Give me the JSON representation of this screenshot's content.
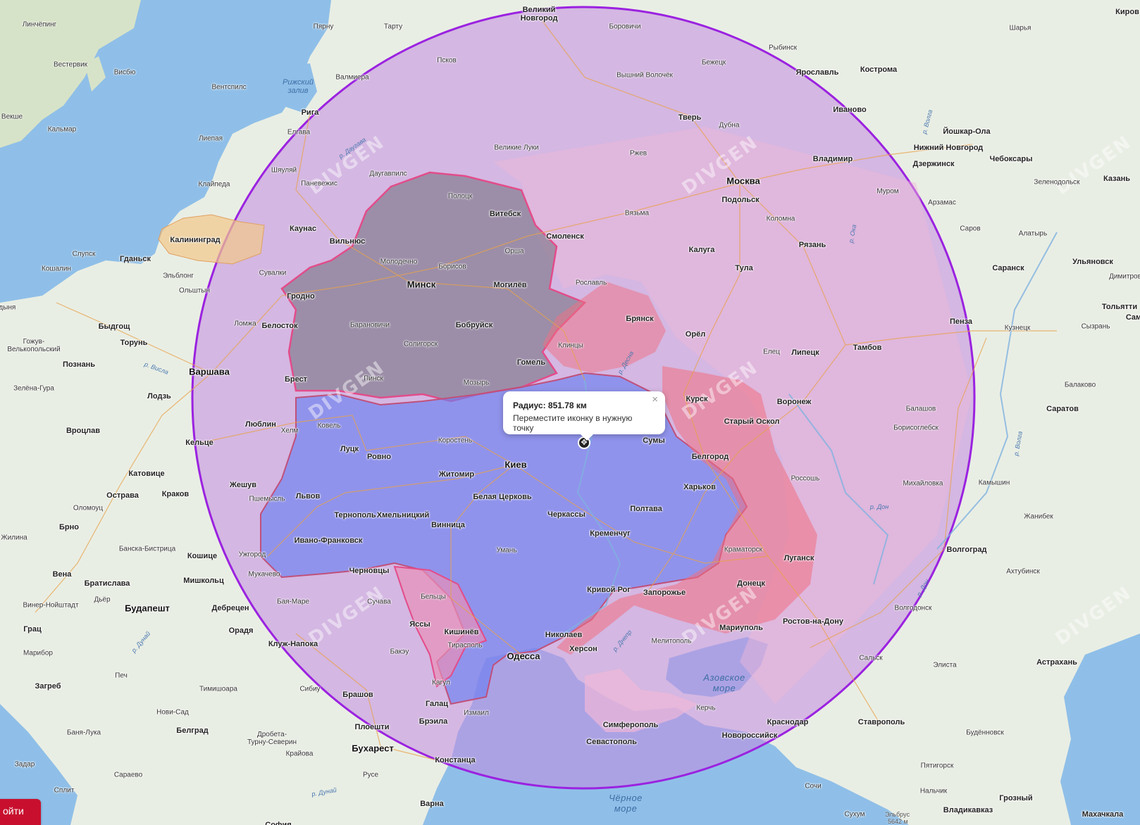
{
  "radius_popup": {
    "title": "Радиус: 851.78 км",
    "hint": "Переместите иконку в нужную точку",
    "close": "×"
  },
  "marker": {
    "glyph": "✥"
  },
  "login_button": {
    "label": "ойти"
  },
  "watermark": "DIVGEN",
  "elbrus": {
    "name": "Эльбрус",
    "height": "5642 м"
  },
  "seas": {
    "azov": "Азовское\nморе",
    "black": "Чёрное\nморе",
    "riga": "Рижский\nзалив"
  },
  "colors": {
    "circle_fill": "#b36bd8",
    "circle_stroke": "#9b22e0",
    "ukraine_fill": "#6b7ff0",
    "belarus_fill": "#6e6e78",
    "russia_fill": "#f0b8d8",
    "occupied_fill": "#f07080",
    "moldova_fill": "#e88fb8",
    "kaliningrad_fill": "#f2c88a"
  },
  "cities": [
    {
      "id": "velikiy-novgorod",
      "name": "Великий\nНовгород",
      "cls": "big"
    },
    {
      "id": "borovichi",
      "name": "Боровичи",
      "cls": "city"
    },
    {
      "id": "rybinsk",
      "name": "Рыбинск",
      "cls": "city"
    },
    {
      "id": "sharya",
      "name": "Шарья",
      "cls": "city"
    },
    {
      "id": "kirov",
      "name": "Киров",
      "cls": "big"
    },
    {
      "id": "linchoping",
      "name": "Линчёпинг",
      "cls": "city"
    },
    {
      "id": "parnu",
      "name": "Пярну",
      "cls": "city"
    },
    {
      "id": "tartu",
      "name": "Тарту",
      "cls": "city"
    },
    {
      "id": "pskov",
      "name": "Псков",
      "cls": "city"
    },
    {
      "id": "bezhetsk",
      "name": "Бежецк",
      "cls": "city"
    },
    {
      "id": "yaroslavl",
      "name": "Ярославль",
      "cls": "big"
    },
    {
      "id": "kostroma",
      "name": "Кострома",
      "cls": "big"
    },
    {
      "id": "vestervik",
      "name": "Вестервик",
      "cls": "city"
    },
    {
      "id": "visbyu",
      "name": "Висбю",
      "cls": "city"
    },
    {
      "id": "valmiera",
      "name": "Валмиера",
      "cls": "city"
    },
    {
      "id": "vyshniy-volochek",
      "name": "Вышний Волочёк",
      "cls": "city"
    },
    {
      "id": "ventspils",
      "name": "Вентспилс",
      "cls": "city"
    },
    {
      "id": "riga",
      "name": "Рига",
      "cls": "big"
    },
    {
      "id": "tver",
      "name": "Тверь",
      "cls": "big"
    },
    {
      "id": "ivanovo",
      "name": "Иваново",
      "cls": "big"
    },
    {
      "id": "vekshe",
      "name": "Векше",
      "cls": "city"
    },
    {
      "id": "kalmar",
      "name": "Кальмар",
      "cls": "city"
    },
    {
      "id": "elgava",
      "name": "Елгава",
      "cls": "city"
    },
    {
      "id": "dubna",
      "name": "Дубна",
      "cls": "city"
    },
    {
      "id": "yoshkar-ola",
      "name": "Йошкар-Ола",
      "cls": "big"
    },
    {
      "id": "liepaya",
      "name": "Лиепая",
      "cls": "city"
    },
    {
      "id": "velikie-luki",
      "name": "Великие Луки",
      "cls": "city"
    },
    {
      "id": "rzhev",
      "name": "Ржев",
      "cls": "city"
    },
    {
      "id": "n-novgorod",
      "name": "Нижний Новгород",
      "cls": "big"
    },
    {
      "id": "cheboksary",
      "name": "Чебоксары",
      "cls": "big"
    },
    {
      "id": "vladimir",
      "name": "Владимир",
      "cls": "big"
    },
    {
      "id": "dzerzhinsk",
      "name": "Дзержинск",
      "cls": "big"
    },
    {
      "id": "shyaulyai",
      "name": "Шяуляй",
      "cls": "city"
    },
    {
      "id": "daugavpils",
      "name": "Даугавпилс",
      "cls": "city"
    },
    {
      "id": "zelenodolsk",
      "name": "Зеленодольск",
      "cls": "city"
    },
    {
      "id": "kazan",
      "name": "Казань",
      "cls": "big"
    },
    {
      "id": "moskva",
      "name": "Москва",
      "cls": "capital"
    },
    {
      "id": "klaipeda",
      "name": "Клайпеда",
      "cls": "city"
    },
    {
      "id": "panevezhis",
      "name": "Паневежис",
      "cls": "city"
    },
    {
      "id": "polotsk",
      "name": "Полоцк",
      "cls": "city"
    },
    {
      "id": "podolsk",
      "name": "Подольск",
      "cls": "big"
    },
    {
      "id": "murom",
      "name": "Муром",
      "cls": "city"
    },
    {
      "id": "arzamas",
      "name": "Арзамас",
      "cls": "city"
    },
    {
      "id": "vitebsk",
      "name": "Витебск",
      "cls": "big"
    },
    {
      "id": "vyazma",
      "name": "Вязьма",
      "cls": "city"
    },
    {
      "id": "kolomna",
      "name": "Коломна",
      "cls": "city"
    },
    {
      "id": "kaliningrad",
      "name": "Калининград",
      "cls": "big"
    },
    {
      "id": "kaunas",
      "name": "Каунас",
      "cls": "big"
    },
    {
      "id": "smolensk",
      "name": "Смоленск",
      "cls": "big"
    },
    {
      "id": "saransk-s",
      "name": "Саров",
      "cls": "city"
    },
    {
      "id": "alatyr",
      "name": "Алатырь",
      "cls": "city"
    },
    {
      "id": "vilnyus",
      "name": "Вильнюс",
      "cls": "big"
    },
    {
      "id": "ryazan",
      "name": "Рязань",
      "cls": "big"
    },
    {
      "id": "orsha",
      "name": "Орша",
      "cls": "city"
    },
    {
      "id": "kaluga",
      "name": "Калуга",
      "cls": "big"
    },
    {
      "id": "slupsk",
      "name": "Слупск",
      "cls": "city"
    },
    {
      "id": "gdansk",
      "name": "Гданьск",
      "cls": "big"
    },
    {
      "id": "ulyanovsk",
      "name": "Ульяновск",
      "cls": "big"
    },
    {
      "id": "molodechno",
      "name": "Молодечно",
      "cls": "city"
    },
    {
      "id": "kosholin",
      "name": "Кошалин",
      "cls": "city"
    },
    {
      "id": "elblong",
      "name": "Эльблонг",
      "cls": "city"
    },
    {
      "id": "suvalki",
      "name": "Сувалки",
      "cls": "city"
    },
    {
      "id": "borisov",
      "name": "Борисов",
      "cls": "city"
    },
    {
      "id": "tula",
      "name": "Тула",
      "cls": "big"
    },
    {
      "id": "saransk",
      "name": "Саранск",
      "cls": "big"
    },
    {
      "id": "dimitrovgrad",
      "name": "Димитров",
      "cls": "city"
    },
    {
      "id": "minsk",
      "name": "Минск",
      "cls": "capital"
    },
    {
      "id": "mogilev",
      "name": "Могилёв",
      "cls": "big"
    },
    {
      "id": "roslavl",
      "name": "Рославль",
      "cls": "city"
    },
    {
      "id": "olshtyn",
      "name": "Ольштын",
      "cls": "city"
    },
    {
      "id": "grodno",
      "name": "Гродно",
      "cls": "big"
    },
    {
      "id": "tolyatti",
      "name": "Тольятти",
      "cls": "big"
    },
    {
      "id": "gdynia",
      "name": "Гдыня",
      "cls": "city"
    },
    {
      "id": "lomzha",
      "name": "Ломжа",
      "cls": "city"
    },
    {
      "id": "bryansk",
      "name": "Брянск",
      "cls": "big"
    },
    {
      "id": "penza",
      "name": "Пенза",
      "cls": "big"
    },
    {
      "id": "syzran",
      "name": "Сызрань",
      "cls": "city"
    },
    {
      "id": "samara",
      "name": "Сам",
      "cls": "big"
    },
    {
      "id": "bydgoshch",
      "name": "Быдгощ",
      "cls": "big"
    },
    {
      "id": "belostok",
      "name": "Белосток",
      "cls": "big"
    },
    {
      "id": "baranovichi",
      "name": "Барановичи",
      "cls": "city"
    },
    {
      "id": "bobruysk",
      "name": "Бобруйск",
      "cls": "big"
    },
    {
      "id": "kuznetsk",
      "name": "Кузнецк",
      "cls": "city"
    },
    {
      "id": "orel",
      "name": "Орёл",
      "cls": "big"
    },
    {
      "id": "torun",
      "name": "Торунь",
      "cls": "big"
    },
    {
      "id": "gozhuv",
      "name": "Гожув-\nВелькопольский",
      "cls": "city"
    },
    {
      "id": "klintsy",
      "name": "Клинцы",
      "cls": "city"
    },
    {
      "id": "soligorsk",
      "name": "Солигорск",
      "cls": "city"
    },
    {
      "id": "tambov",
      "name": "Тамбов",
      "cls": "big"
    },
    {
      "id": "elets",
      "name": "Елец",
      "cls": "city"
    },
    {
      "id": "lipetsk",
      "name": "Липецк",
      "cls": "big"
    },
    {
      "id": "poznan",
      "name": "Познань",
      "cls": "big"
    },
    {
      "id": "gomel",
      "name": "Гомель",
      "cls": "big"
    },
    {
      "id": "varshava",
      "name": "Варшава",
      "cls": "capital"
    },
    {
      "id": "brest",
      "name": "Брест",
      "cls": "big"
    },
    {
      "id": "pinsk",
      "name": "Пинск",
      "cls": "city"
    },
    {
      "id": "mozyr",
      "name": "Мозырь",
      "cls": "city"
    },
    {
      "id": "balakovo",
      "name": "Балаково",
      "cls": "city"
    },
    {
      "id": "zelena-gura",
      "name": "Зелёна-Гура",
      "cls": "city"
    },
    {
      "id": "lodz",
      "name": "Лодзь",
      "cls": "big"
    },
    {
      "id": "kursk",
      "name": "Курск",
      "cls": "big"
    },
    {
      "id": "voronezh",
      "name": "Воронеж",
      "cls": "big"
    },
    {
      "id": "balashov",
      "name": "Балашов",
      "cls": "city"
    },
    {
      "id": "saratov",
      "name": "Саратов",
      "cls": "big"
    },
    {
      "id": "kovel",
      "name": "Ковель",
      "cls": "city"
    },
    {
      "id": "lyublin",
      "name": "Люблин",
      "cls": "big"
    },
    {
      "id": "staryy-oskol",
      "name": "Старый Оскол",
      "cls": "big"
    },
    {
      "id": "borisoglebsk",
      "name": "Борисоглебск",
      "cls": "city"
    },
    {
      "id": "vrotslav",
      "name": "Вроцлав",
      "cls": "big"
    },
    {
      "id": "khelm",
      "name": "Хелм",
      "cls": "city"
    },
    {
      "id": "korosten",
      "name": "Коростень",
      "cls": "city"
    },
    {
      "id": "sumy",
      "name": "Сумы",
      "cls": "big"
    },
    {
      "id": "keltse",
      "name": "Кельце",
      "cls": "big"
    },
    {
      "id": "lutsk",
      "name": "Луцк",
      "cls": "big"
    },
    {
      "id": "rovno",
      "name": "Ровно",
      "cls": "big"
    },
    {
      "id": "belgorod",
      "name": "Белгород",
      "cls": "big"
    },
    {
      "id": "kiev",
      "name": "Киев",
      "cls": "capital"
    },
    {
      "id": "katovitse",
      "name": "Катовице",
      "cls": "big"
    },
    {
      "id": "zhitomir",
      "name": "Житомир",
      "cls": "big"
    },
    {
      "id": "rossosh",
      "name": "Россошь",
      "cls": "city"
    },
    {
      "id": "kamyshin",
      "name": "Камышин",
      "cls": "city"
    },
    {
      "id": "mikhaylovka",
      "name": "Михайловка",
      "cls": "city"
    },
    {
      "id": "zheshuv",
      "name": "Жешув",
      "cls": "big"
    },
    {
      "id": "kharkov",
      "name": "Харьков",
      "cls": "big"
    },
    {
      "id": "opava",
      "name": "Острава",
      "cls": "big"
    },
    {
      "id": "krakov",
      "name": "Краков",
      "cls": "big"
    },
    {
      "id": "lvov",
      "name": "Львов",
      "cls": "big"
    },
    {
      "id": "belaya-tserkov",
      "name": "Белая Церковь",
      "cls": "big"
    },
    {
      "id": "peremyshl",
      "name": "Пшемысль",
      "cls": "city"
    },
    {
      "id": "olomouts",
      "name": "Оломоуц",
      "cls": "city"
    },
    {
      "id": "poltava",
      "name": "Полтава",
      "cls": "big"
    },
    {
      "id": "ternopol",
      "name": "Тернополь",
      "cls": "big"
    },
    {
      "id": "khmelnitskiy",
      "name": "Хмельницкий",
      "cls": "big"
    },
    {
      "id": "cherkassy",
      "name": "Черкассы",
      "cls": "big"
    },
    {
      "id": "zhanibek",
      "name": "Жанибек",
      "cls": "city"
    },
    {
      "id": "brno",
      "name": "Брно",
      "cls": "big"
    },
    {
      "id": "vinnitsa",
      "name": "Винница",
      "cls": "big"
    },
    {
      "id": "kremenchug",
      "name": "Кременчуг",
      "cls": "big"
    },
    {
      "id": "zhilina",
      "name": "Жилина",
      "cls": "city"
    },
    {
      "id": "ivano-frankovsk",
      "name": "Ивано-Франковск",
      "cls": "big"
    },
    {
      "id": "banska",
      "name": "Банска-Бистрица",
      "cls": "city"
    },
    {
      "id": "uman",
      "name": "Умань",
      "cls": "city"
    },
    {
      "id": "kramatorsk",
      "name": "Краматорск",
      "cls": "city"
    },
    {
      "id": "volgograd",
      "name": "Волгоград",
      "cls": "big"
    },
    {
      "id": "uzhgorod",
      "name": "Ужгород",
      "cls": "city"
    },
    {
      "id": "koshitse",
      "name": "Кошице",
      "cls": "big"
    },
    {
      "id": "lugansk",
      "name": "Луганск",
      "cls": "big"
    },
    {
      "id": "akhtubinsk",
      "name": "Ахтубинск",
      "cls": "city"
    },
    {
      "id": "vena",
      "name": "Вена",
      "cls": "big"
    },
    {
      "id": "chernovtsy",
      "name": "Черновцы",
      "cls": "big"
    },
    {
      "id": "mukachevo",
      "name": "Мукачево",
      "cls": "city"
    },
    {
      "id": "bratislava",
      "name": "Братислава",
      "cls": "big"
    },
    {
      "id": "mishkolts",
      "name": "Мишкольц",
      "cls": "big"
    },
    {
      "id": "krivoy-rog",
      "name": "Кривой Рог",
      "cls": "big"
    },
    {
      "id": "donetsk",
      "name": "Донецк",
      "cls": "big"
    },
    {
      "id": "zaporozhe",
      "name": "Запорожье",
      "cls": "big"
    },
    {
      "id": "dyor",
      "name": "Дьёр",
      "cls": "city"
    },
    {
      "id": "baya-mare",
      "name": "Бая-Маре",
      "cls": "city"
    },
    {
      "id": "beltsy",
      "name": "Бельцы",
      "cls": "city"
    },
    {
      "id": "suchava",
      "name": "Сучава",
      "cls": "city"
    },
    {
      "id": "volgodonsk",
      "name": "Волгодонск",
      "cls": "city"
    },
    {
      "id": "viner-noyshtadt",
      "name": "Винер-Нойштадт",
      "cls": "city"
    },
    {
      "id": "budapesht",
      "name": "Будапешт",
      "cls": "capital"
    },
    {
      "id": "debretsen",
      "name": "Дебрецен",
      "cls": "big"
    },
    {
      "id": "yassy",
      "name": "Яссы",
      "cls": "big"
    },
    {
      "id": "kishinev",
      "name": "Кишинёв",
      "cls": "big"
    },
    {
      "id": "mariupol",
      "name": "Мариуполь",
      "cls": "big"
    },
    {
      "id": "rostov",
      "name": "Ростов-на-Дону",
      "cls": "big"
    },
    {
      "id": "graz",
      "name": "Грац",
      "cls": "big"
    },
    {
      "id": "oradya",
      "name": "Орадя",
      "cls": "big"
    },
    {
      "id": "nikolaev",
      "name": "Николаев",
      "cls": "big"
    },
    {
      "id": "tiraspol",
      "name": "Тирасполь",
      "cls": "city"
    },
    {
      "id": "melitopol",
      "name": "Мелитополь",
      "cls": "city"
    },
    {
      "id": "kluzh",
      "name": "Клуж-Напока",
      "cls": "big"
    },
    {
      "id": "kherson",
      "name": "Херсон",
      "cls": "big"
    },
    {
      "id": "maribor",
      "name": "Марибор",
      "cls": "city"
    },
    {
      "id": "bakeu",
      "name": "Бакэу",
      "cls": "city"
    },
    {
      "id": "odessa",
      "name": "Одесса",
      "cls": "capital"
    },
    {
      "id": "salsk",
      "name": "Сальск",
      "cls": "city"
    },
    {
      "id": "elista",
      "name": "Элиста",
      "cls": "city"
    },
    {
      "id": "astrakhan",
      "name": "Астрахань",
      "cls": "big"
    },
    {
      "id": "pech",
      "name": "Печ",
      "cls": "city"
    },
    {
      "id": "timishoara",
      "name": "Тимишоара",
      "cls": "city"
    },
    {
      "id": "sibiu",
      "name": "Сибиу",
      "cls": "city"
    },
    {
      "id": "kagul",
      "name": "Кагул",
      "cls": "city"
    },
    {
      "id": "zagreb",
      "name": "Загреб",
      "cls": "big"
    },
    {
      "id": "braszhov",
      "name": "Брашов",
      "cls": "big"
    },
    {
      "id": "kerch",
      "name": "Керчь",
      "cls": "city"
    },
    {
      "id": "galats",
      "name": "Галац",
      "cls": "big"
    },
    {
      "id": "novi-sad",
      "name": "Нови-Сад",
      "cls": "city"
    },
    {
      "id": "izmail",
      "name": "Измаил",
      "cls": "city"
    },
    {
      "id": "braila",
      "name": "Брэила",
      "cls": "big"
    },
    {
      "id": "krasnodar",
      "name": "Краснодар",
      "cls": "big"
    },
    {
      "id": "stavropol",
      "name": "Ставрополь",
      "cls": "big"
    },
    {
      "id": "simferopol",
      "name": "Симферополь",
      "cls": "big"
    },
    {
      "id": "belgrad",
      "name": "Белград",
      "cls": "big"
    },
    {
      "id": "banya-luka",
      "name": "Баня-Лука",
      "cls": "city"
    },
    {
      "id": "ploeshti",
      "name": "Плоешти",
      "cls": "big"
    },
    {
      "id": "drobeta",
      "name": "Дробета-\nТурну-Северин",
      "cls": "city"
    },
    {
      "id": "budennovsk",
      "name": "Будённовск",
      "cls": "city"
    },
    {
      "id": "sevastopol",
      "name": "Севастополь",
      "cls": "big"
    },
    {
      "id": "novorossiysk",
      "name": "Новороссийск",
      "cls": "big"
    },
    {
      "id": "buharest",
      "name": "Бухарест",
      "cls": "capital"
    },
    {
      "id": "krayova",
      "name": "Крайова",
      "cls": "city"
    },
    {
      "id": "konstantsa",
      "name": "Констанца",
      "cls": "big"
    },
    {
      "id": "zadar",
      "name": "Задар",
      "cls": "city"
    },
    {
      "id": "saraevo",
      "name": "Сараево",
      "cls": "city"
    },
    {
      "id": "pyatigorsk",
      "name": "Пятигорск",
      "cls": "city"
    },
    {
      "id": "ruse",
      "name": "Русе",
      "cls": "city"
    },
    {
      "id": "split",
      "name": "Сплит",
      "cls": "city"
    },
    {
      "id": "sochi",
      "name": "Сочи",
      "cls": "city"
    },
    {
      "id": "nalchik",
      "name": "Нальчик",
      "cls": "city"
    },
    {
      "id": "groznyy",
      "name": "Грозный",
      "cls": "big"
    },
    {
      "id": "varna",
      "name": "Варна",
      "cls": "big"
    },
    {
      "id": "sukhum",
      "name": "Сухум",
      "cls": "city"
    },
    {
      "id": "vladikavkaz",
      "name": "Владикавказ",
      "cls": "big"
    },
    {
      "id": "makhachkala",
      "name": "Махачкала",
      "cls": "big"
    },
    {
      "id": "sofia",
      "name": "София",
      "cls": "big"
    }
  ],
  "rivers": [
    {
      "id": "daugava",
      "name": "р. Даугава"
    },
    {
      "id": "volga1",
      "name": "р. Волга"
    },
    {
      "id": "oka",
      "name": "р. Ока"
    },
    {
      "id": "visla",
      "name": "р. Висла"
    },
    {
      "id": "desna",
      "name": "р. Десна"
    },
    {
      "id": "don1",
      "name": "р. Дон"
    },
    {
      "id": "don2",
      "name": "р. Дон"
    },
    {
      "id": "volga2",
      "name": "р. Волга"
    },
    {
      "id": "dnepr",
      "name": "р. Днепр"
    },
    {
      "id": "dunay1",
      "name": "р. Дунай"
    },
    {
      "id": "dunay2",
      "name": "р. Дунай"
    }
  ]
}
